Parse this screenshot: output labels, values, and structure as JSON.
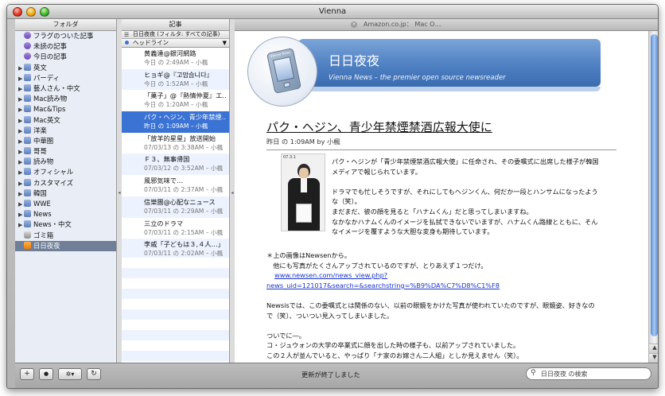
{
  "window": {
    "title": "Vienna"
  },
  "folders": {
    "header": "フォルダ",
    "items": [
      {
        "label": "フラグのついた記事",
        "icon": "smart-folder-icon",
        "kind": "smart",
        "expandable": false,
        "selected": false
      },
      {
        "label": "未読の記事",
        "icon": "smart-folder-icon",
        "kind": "smart",
        "expandable": false,
        "selected": false
      },
      {
        "label": "今日の記事",
        "icon": "smart-folder-icon",
        "kind": "smart",
        "expandable": false,
        "selected": false
      },
      {
        "label": "英文",
        "icon": "folder-icon",
        "kind": "group",
        "expandable": true,
        "selected": false
      },
      {
        "label": "パーディ",
        "icon": "folder-icon",
        "kind": "group",
        "expandable": true,
        "selected": false
      },
      {
        "label": "藝人さん・中文",
        "icon": "folder-icon",
        "kind": "group",
        "expandable": true,
        "selected": false
      },
      {
        "label": "Mac読み物",
        "icon": "folder-icon",
        "kind": "group",
        "expandable": true,
        "selected": false
      },
      {
        "label": "Mac&Tips",
        "icon": "folder-icon",
        "kind": "group",
        "expandable": true,
        "selected": false
      },
      {
        "label": "Mac英文",
        "icon": "folder-icon",
        "kind": "group",
        "expandable": true,
        "selected": false
      },
      {
        "label": "洋楽",
        "icon": "folder-icon",
        "kind": "group",
        "expandable": true,
        "selected": false
      },
      {
        "label": "中華圏",
        "icon": "folder-icon",
        "kind": "group",
        "expandable": true,
        "selected": false
      },
      {
        "label": "哥哥",
        "icon": "folder-icon",
        "kind": "group",
        "expandable": true,
        "selected": false
      },
      {
        "label": "読み物",
        "icon": "folder-icon",
        "kind": "group",
        "expandable": true,
        "selected": false
      },
      {
        "label": "オフィシャル",
        "icon": "folder-icon",
        "kind": "group",
        "expandable": true,
        "selected": false
      },
      {
        "label": "カスタマイズ",
        "icon": "folder-icon",
        "kind": "group",
        "expandable": true,
        "selected": false
      },
      {
        "label": "韓国",
        "icon": "folder-icon",
        "kind": "group",
        "expandable": true,
        "selected": false
      },
      {
        "label": "WWE",
        "icon": "folder-icon",
        "kind": "group",
        "expandable": true,
        "selected": false
      },
      {
        "label": "News",
        "icon": "folder-icon",
        "kind": "group",
        "expandable": true,
        "selected": false
      },
      {
        "label": "News・中文",
        "icon": "folder-icon",
        "kind": "group",
        "expandable": true,
        "selected": false
      },
      {
        "label": "ゴミ箱",
        "icon": "trash-icon",
        "kind": "trash",
        "expandable": false,
        "selected": false
      },
      {
        "label": "日日夜夜",
        "icon": "rss-feed-icon",
        "kind": "rss",
        "expandable": false,
        "selected": true
      }
    ]
  },
  "article_list": {
    "filter_label": "日日夜夜 (フィルタ: すべての記事)",
    "column_label": "ヘッドライン",
    "rows": [
      {
        "title": "黄義達@銀河網路",
        "meta": "今日 の 2:49AM – 小楓",
        "selected": false
      },
      {
        "title": "ヒョギ@『고맙습니다』",
        "meta": "今日 の 1:52AM – 小楓",
        "selected": false
      },
      {
        "title": "「菓子」@『熱情仲夏』エ…",
        "meta": "今日 の 1:20AM – 小楓",
        "selected": false
      },
      {
        "title": "パク・ヘジン、青少年禁煙…",
        "meta": "昨日 の 1:09AM – 小楓",
        "selected": true
      },
      {
        "title": "「放羊的星星」放送開始",
        "meta": "07/03/13 の 3:38AM – 小楓",
        "selected": false
      },
      {
        "title": "Ｆ３、無事帰国",
        "meta": "07/03/12 の 3:52AM – 小楓",
        "selected": false
      },
      {
        "title": "風邪気味で…",
        "meta": "07/03/11 の 2:37AM – 小楓",
        "selected": false
      },
      {
        "title": "信樂團@心配なニュース",
        "meta": "07/03/11 の 2:29AM – 小楓",
        "selected": false
      },
      {
        "title": "三立のドラマ",
        "meta": "07/03/11 の 2:15AM – 小楓",
        "selected": false
      },
      {
        "title": "李威「子どもは３,４人…」",
        "meta": "07/03/11 の 2:02AM – 小楓",
        "selected": false
      }
    ]
  },
  "tabs": {
    "articles": "記事",
    "web": "Amazon.co.jp： Mac O…"
  },
  "feed": {
    "title": "日日夜夜",
    "subtitle": "Vienna News – the premier open source newsreader",
    "device_label": "Vienna News"
  },
  "article": {
    "headline": "パク・ヘジン、青少年禁煙禁酒広報大使に",
    "byline": "昨日 の 1:09AM by 小楓",
    "photo_caption": "07.3.1",
    "para1": [
      "パク・ヘジンが「青少年禁煙禁酒広報大使」に任命され、その委嘱式に出席した様子が韓国",
      "メディアで報じられています。",
      "",
      "ドラマでも忙しそうですが、それにしてもヘジンくん、何だか一段とハンサムになったよう",
      "な（笑）。",
      "まだまだ、彼の顔を見ると「ハナムくん」だと思ってしまいますね。",
      "なかなかハナムくんのイメージを払拭できないでいますが、ハナムくん路線とともに、そん",
      "なイメージを覆すような大胆な変身も期待しています。"
    ],
    "note_line1": "＊上の画像はNewsenから。",
    "note_line2": "　他にも写真がたくさんアップされているのですが、とりあえず１つだけ。",
    "link_line1": "www.newsen.com/news_view.php?",
    "link_line2": "news_uid=121017&search=&searchstring=%B9%DA%C7%D8%C1%F8",
    "para3": [
      "Newsisでは、この委嘱式とは関係のない、以前の眼鏡をかけた写真が使われていたのですが、眼鏡姿、好きなの",
      "で（笑）、ついつい見入ってしまいました。",
      "",
      "ついでに―。",
      "コ・ジュウォンの大学の卒業式に顔を出した時の様子も、以前アップされていました。",
      "この２人が並んでいると、やっぱり「ナ家のお嫁さん二人組」としか見えません（笑）。"
    ]
  },
  "status": {
    "text": "更新が終了しました"
  },
  "search": {
    "placeholder": "日日夜夜 の検索"
  },
  "toolbar": {
    "add": "+",
    "refresh": "↻",
    "gear": "✲▾",
    "dot": "●"
  }
}
